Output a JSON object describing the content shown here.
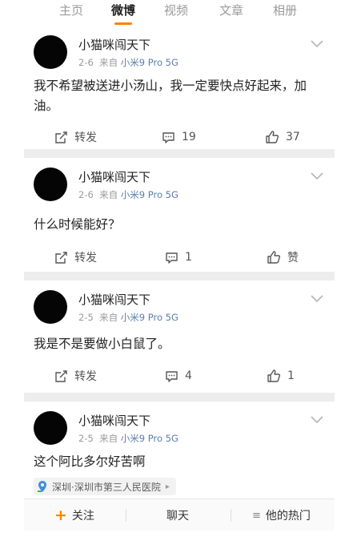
{
  "tabs": [
    "主页",
    "微博",
    "视频",
    "文章",
    "相册"
  ],
  "active_tab": "微博",
  "posts": [
    {
      "username": "小猫咪闯天下",
      "date": "2-6",
      "source_prefix": "来自",
      "source": "小米9 Pro 5G",
      "text": "我不希望被送进小汤山，我一定要快点好起来，加油。",
      "repost_label": "转发",
      "comments": "19",
      "likes": "37"
    },
    {
      "username": "小猫咪闯天下",
      "date": "2-6",
      "source_prefix": "来自",
      "source": "小米9 Pro 5G",
      "text": "什么时候能好？",
      "repost_label": "转发",
      "comments": "1",
      "likes": "赞"
    },
    {
      "username": "小猫咪闯天下",
      "date": "2-5",
      "source_prefix": "来自",
      "source": "小米9 Pro 5G",
      "text": "我是不是要做小白鼠了。",
      "repost_label": "转发",
      "comments": "4",
      "likes": "1"
    },
    {
      "username": "小猫咪闯天下",
      "date": "2-5",
      "source_prefix": "来自",
      "source": "小米9 Pro 5G",
      "text": "这个阿比多尔好苦啊",
      "location": "深圳·深圳市第三人民医院"
    }
  ],
  "bottom_bar": {
    "follow_label": "关注",
    "chat_label": "聊天",
    "hot_label": "他的热门"
  },
  "colors": {
    "accent": "#ff8200",
    "source_link": "#5b7ea8",
    "separator": "#ededed"
  }
}
